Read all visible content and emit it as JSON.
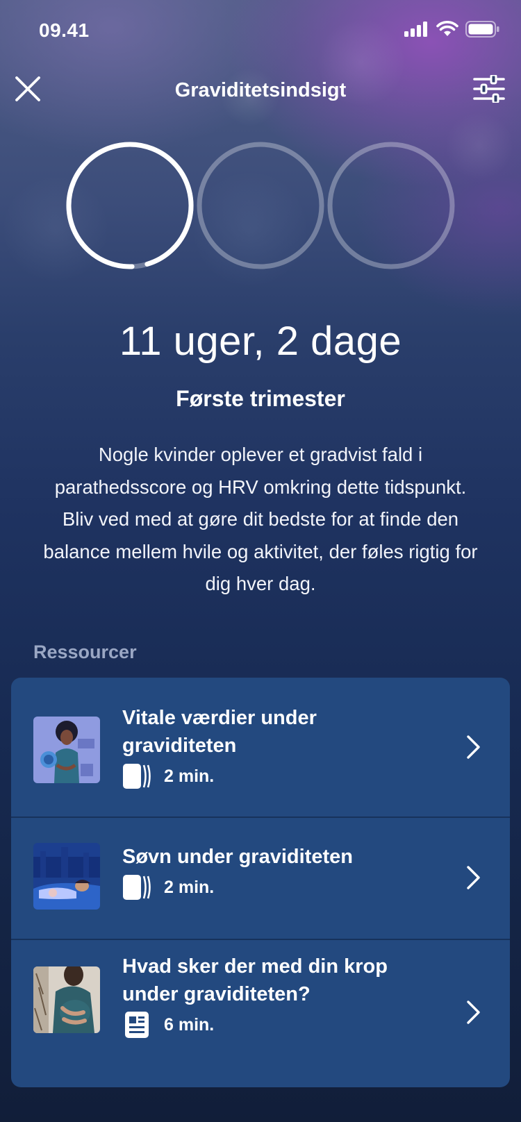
{
  "status_bar": {
    "time": "09.41",
    "signal_icon": "cellular-signal-icon",
    "wifi_icon": "wifi-icon",
    "battery_icon": "battery-icon"
  },
  "header": {
    "title": "Graviditetsindsigt",
    "close_icon": "close-icon",
    "filter_icon": "settings-sliders-icon"
  },
  "trimester_rings": {
    "count": 3,
    "active_index": 0,
    "active_progress": 0.96,
    "active_color": "#ffffff",
    "inactive_color": "rgba(255,255,255,0.3)"
  },
  "progress": {
    "duration": "11 uger, 2 dage",
    "trimester": "Første trimester",
    "description": "Nogle kvinder oplever et gradvist fald i parathedsscore og HRV omkring dette tidspunkt. Bliv ved med at gøre dit bedste for at finde den balance mellem hvile og aktivitet, der føles rigtig for dig hver dag."
  },
  "resources": {
    "label": "Ressourcer",
    "items": [
      {
        "title": "Vitale værdier under graviditeten",
        "duration": "2 min.",
        "type_icon": "audio-icon",
        "thumbnail": "illustration-pregnant-woman-vitals"
      },
      {
        "title": "Søvn under graviditeten",
        "duration": "2 min.",
        "type_icon": "audio-icon",
        "thumbnail": "illustration-sleeping-woman"
      },
      {
        "title": "Hvad sker der med din krop under graviditeten?",
        "duration": "6 min.",
        "type_icon": "article-icon",
        "thumbnail": "photo-pregnant-woman"
      }
    ]
  },
  "colors": {
    "card_background": "#23497f",
    "section_label": "#9aa7c4",
    "text": "#ffffff"
  }
}
